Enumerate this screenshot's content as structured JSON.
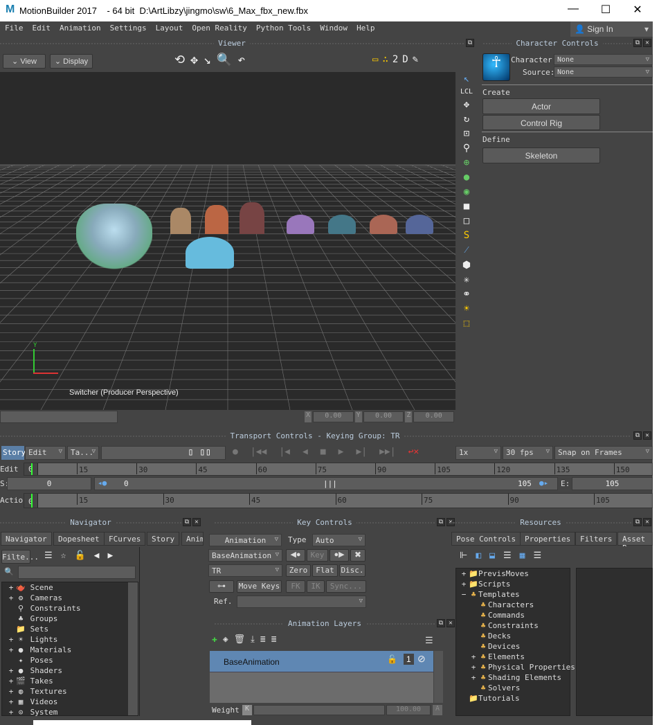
{
  "window": {
    "app": "MotionBuilder 2017",
    "bits": "- 64 bit",
    "file": "D:\\ArtLibzy\\jingmo\\sw\\6_Max_fbx_new.fbx",
    "logo": "M"
  },
  "menu": [
    "File",
    "Edit",
    "Animation",
    "Settings",
    "Layout",
    "Open Reality",
    "Python Tools",
    "Window",
    "Help"
  ],
  "signin": "Sign In",
  "viewer": {
    "title": "Viewer",
    "view": "View",
    "display": "Display",
    "camera_label": "Switcher (Producer Perspective)",
    "x_label": "X",
    "x": "0.00",
    "y_label": "Y",
    "y": "0.00",
    "z_label": "Z",
    "z": "0.00",
    "axis_y": "Y"
  },
  "character_controls": {
    "title": "Character Controls",
    "character_label": "Character:",
    "character": "None",
    "source_label": "Source:",
    "source": "None",
    "create": "Create",
    "actor": "Actor",
    "control_rig": "Control Rig",
    "define": "Define",
    "skeleton": "Skeleton"
  },
  "transport": {
    "title": "Transport Controls  -  Keying Group: TR",
    "story": "Story",
    "edit": "Edit",
    "ta": "Ta...",
    "speed": "1x",
    "fps": "30 fps",
    "snap": "Snap on Frames",
    "edit_label": "Edit",
    "action_label": "Action",
    "s_label": "S:",
    "s_value": "0",
    "e_label": "E:",
    "e_value": "105",
    "range_start": "0",
    "range_end": "105",
    "current_frame": "0",
    "edit_ticks": [
      "15",
      "30",
      "45",
      "60",
      "75",
      "90",
      "105",
      "120",
      "135",
      "150"
    ],
    "action_ticks": [
      "15",
      "30",
      "45",
      "60",
      "75",
      "90",
      "105"
    ]
  },
  "navigator": {
    "title": "Navigator",
    "tabs": [
      "Navigator",
      "Dopesheet",
      "FCurves",
      "Story",
      "Anim"
    ],
    "filter": "Filte...",
    "items": [
      {
        "label": "Scene",
        "expand": true
      },
      {
        "label": "Cameras",
        "expand": true
      },
      {
        "label": "Constraints",
        "expand": false
      },
      {
        "label": "Groups",
        "expand": false
      },
      {
        "label": "Sets",
        "expand": false
      },
      {
        "label": "Lights",
        "expand": true
      },
      {
        "label": "Materials",
        "expand": true
      },
      {
        "label": "Poses",
        "expand": false
      },
      {
        "label": "Shaders",
        "expand": true
      },
      {
        "label": "Takes",
        "expand": true
      },
      {
        "label": "Textures",
        "expand": true
      },
      {
        "label": "Videos",
        "expand": true
      },
      {
        "label": "System",
        "expand": true
      }
    ]
  },
  "key_controls": {
    "title": "Key Controls",
    "animation": "Animation",
    "type_label": "Type",
    "type": "Auto",
    "layer": "BaseAnimation",
    "key": "Key",
    "group": "TR",
    "zero": "Zero",
    "flat": "Flat",
    "disc": "Disc.",
    "move_keys": "Move Keys",
    "fk": "FK",
    "ik": "IK",
    "sync": "Sync...",
    "ref": "Ref."
  },
  "animation_layers": {
    "title": "Animation Layers",
    "layers": [
      "BaseAnimation"
    ],
    "weight_label": "Weight",
    "weight": "100.00",
    "k": "K",
    "a": "A"
  },
  "resources": {
    "title": "Resources",
    "tabs": [
      "Pose Controls",
      "Properties",
      "Filters",
      "Asset B"
    ],
    "items": [
      {
        "label": "PrevisMoves",
        "level": 0,
        "expand": "+"
      },
      {
        "label": "Scripts",
        "level": 0,
        "expand": "+"
      },
      {
        "label": "Templates",
        "level": 0,
        "expand": "−"
      },
      {
        "label": "Characters",
        "level": 1,
        "expand": ""
      },
      {
        "label": "Commands",
        "level": 1,
        "expand": ""
      },
      {
        "label": "Constraints",
        "level": 1,
        "expand": ""
      },
      {
        "label": "Decks",
        "level": 1,
        "expand": ""
      },
      {
        "label": "Devices",
        "level": 1,
        "expand": ""
      },
      {
        "label": "Elements",
        "level": 1,
        "expand": "+"
      },
      {
        "label": "Physical Properties",
        "level": 1,
        "expand": "+"
      },
      {
        "label": "Shading Elements",
        "level": 1,
        "expand": "+"
      },
      {
        "label": "Solvers",
        "level": 1,
        "expand": ""
      },
      {
        "label": "Tutorials",
        "level": 0,
        "expand": ""
      }
    ]
  },
  "colors": {
    "accent": "#5b7fa6",
    "selection": "#5f87b3",
    "bg": "#444444",
    "viewport": "#2a2a2a"
  }
}
